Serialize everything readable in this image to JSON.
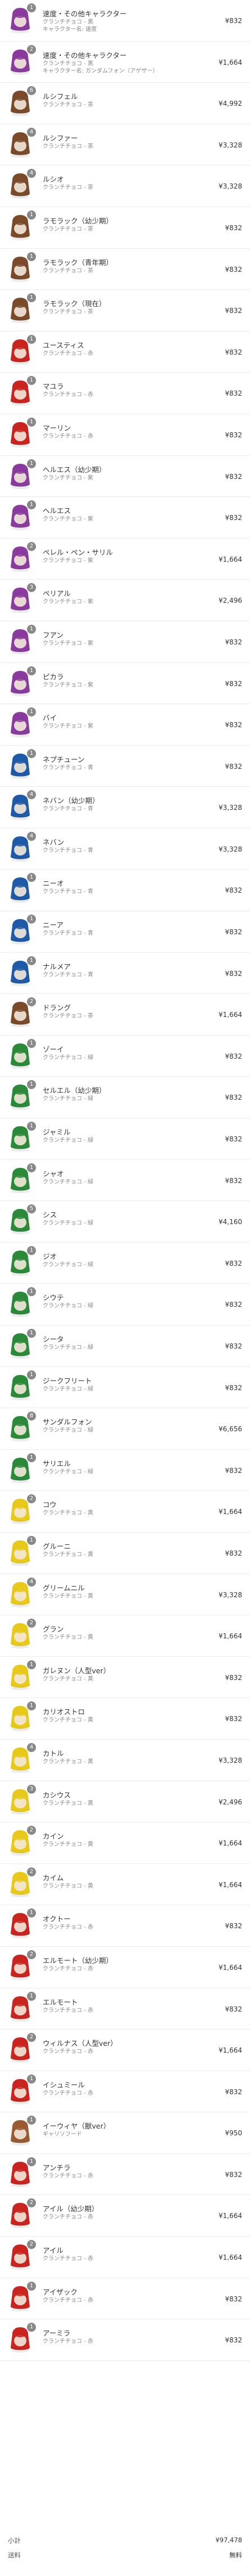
{
  "items": [
    {
      "name": "速度・その他キャラクター",
      "subs": [
        "クランチチョコ - 黒",
        "キャラクター名: 速度"
      ],
      "price": "¥832",
      "qty": "1",
      "color": "#8a3b9e"
    },
    {
      "name": "速度・その他キャラクター",
      "subs": [
        "クランチチョコ - 黒",
        "キャラクター名: ガンダムフォン（アゲザー）"
      ],
      "price": "¥1,664",
      "qty": "2",
      "color": "#8a3b9e"
    },
    {
      "name": "ルシフェル",
      "subs": [
        "クランチチョコ - 茶"
      ],
      "price": "¥4,992",
      "qty": "6",
      "color": "#7a4a2a"
    },
    {
      "name": "ルシファー",
      "subs": [
        "クランチチョコ - 茶"
      ],
      "price": "¥3,328",
      "qty": "4",
      "color": "#7a4a2a"
    },
    {
      "name": "ルシオ",
      "subs": [
        "クランチチョコ - 茶"
      ],
      "price": "¥3,328",
      "qty": "4",
      "color": "#7a4a2a"
    },
    {
      "name": "ラモラック（幼少期）",
      "subs": [
        "クランチチョコ - 茶"
      ],
      "price": "¥832",
      "qty": "1",
      "color": "#7a4a2a"
    },
    {
      "name": "ラモラック（青年期）",
      "subs": [
        "クランチチョコ - 茶"
      ],
      "price": "¥832",
      "qty": "1",
      "color": "#7a4a2a"
    },
    {
      "name": "ラモラック（現在）",
      "subs": [
        "クランチチョコ - 茶"
      ],
      "price": "¥832",
      "qty": "1",
      "color": "#7a4a2a"
    },
    {
      "name": "ユースティス",
      "subs": [
        "クランチチョコ - 赤"
      ],
      "price": "¥832",
      "qty": "1",
      "color": "#c9241f"
    },
    {
      "name": "マユラ",
      "subs": [
        "クランチチョコ - 赤"
      ],
      "price": "¥832",
      "qty": "1",
      "color": "#c9241f"
    },
    {
      "name": "マーリン",
      "subs": [
        "クランチチョコ - 赤"
      ],
      "price": "¥832",
      "qty": "1",
      "color": "#c9241f"
    },
    {
      "name": "ヘルエス（幼少期）",
      "subs": [
        "クランチチョコ - 紫"
      ],
      "price": "¥832",
      "qty": "1",
      "color": "#8a3b9e"
    },
    {
      "name": "ヘルエス",
      "subs": [
        "クランチチョコ - 紫"
      ],
      "price": "¥832",
      "qty": "1",
      "color": "#8a3b9e"
    },
    {
      "name": "ペレル・ペン・サリル",
      "subs": [
        "クランチチョコ - 紫"
      ],
      "price": "¥1,664",
      "qty": "2",
      "color": "#8a3b9e"
    },
    {
      "name": "ペリアル",
      "subs": [
        "クランチチョコ - 紫"
      ],
      "price": "¥2,496",
      "qty": "3",
      "color": "#8a3b9e"
    },
    {
      "name": "フアン",
      "subs": [
        "クランチチョコ - 紫"
      ],
      "price": "¥832",
      "qty": "1",
      "color": "#8a3b9e"
    },
    {
      "name": "ピカラ",
      "subs": [
        "クランチチョコ - 紫"
      ],
      "price": "¥832",
      "qty": "1",
      "color": "#8a3b9e"
    },
    {
      "name": "バイ",
      "subs": [
        "クランチチョコ - 紫"
      ],
      "price": "¥832",
      "qty": "1",
      "color": "#8a3b9e"
    },
    {
      "name": "ネプチューン",
      "subs": [
        "クランチチョコ - 青"
      ],
      "price": "¥832",
      "qty": "1",
      "color": "#1f5aa8"
    },
    {
      "name": "ネバン（幼少期）",
      "subs": [
        "クランチチョコ - 青"
      ],
      "price": "¥3,328",
      "qty": "4",
      "color": "#1f5aa8"
    },
    {
      "name": "ネバン",
      "subs": [
        "クランチチョコ - 青"
      ],
      "price": "¥3,328",
      "qty": "4",
      "color": "#1f5aa8"
    },
    {
      "name": "ニーオ",
      "subs": [
        "クランチチョコ - 青"
      ],
      "price": "¥832",
      "qty": "1",
      "color": "#1f5aa8"
    },
    {
      "name": "ニーア",
      "subs": [
        "クランチチョコ - 青"
      ],
      "price": "¥832",
      "qty": "1",
      "color": "#1f5aa8"
    },
    {
      "name": "ナルメア",
      "subs": [
        "クランチチョコ - 青"
      ],
      "price": "¥832",
      "qty": "1",
      "color": "#1f5aa8"
    },
    {
      "name": "ドラング",
      "subs": [
        "クランチチョコ - 茶"
      ],
      "price": "¥1,664",
      "qty": "2",
      "color": "#7a4a2a"
    },
    {
      "name": "ゾーイ",
      "subs": [
        "クランチチョコ - 緑"
      ],
      "price": "¥832",
      "qty": "1",
      "color": "#2a8a3a"
    },
    {
      "name": "セルエル（幼少期）",
      "subs": [
        "クランチチョコ - 緑"
      ],
      "price": "¥832",
      "qty": "1",
      "color": "#2a8a3a"
    },
    {
      "name": "ジャミル",
      "subs": [
        "クランチチョコ - 緑"
      ],
      "price": "¥832",
      "qty": "1",
      "color": "#2a8a3a"
    },
    {
      "name": "シャオ",
      "subs": [
        "クランチチョコ - 緑"
      ],
      "price": "¥832",
      "qty": "1",
      "color": "#2a8a3a"
    },
    {
      "name": "シス",
      "subs": [
        "クランチチョコ - 緑"
      ],
      "price": "¥4,160",
      "qty": "5",
      "color": "#2a8a3a"
    },
    {
      "name": "ジオ",
      "subs": [
        "クランチチョコ - 緑"
      ],
      "price": "¥832",
      "qty": "1",
      "color": "#2a8a3a"
    },
    {
      "name": "シウテ",
      "subs": [
        "クランチチョコ - 緑"
      ],
      "price": "¥832",
      "qty": "1",
      "color": "#2a8a3a"
    },
    {
      "name": "シータ",
      "subs": [
        "クランチチョコ - 緑"
      ],
      "price": "¥832",
      "qty": "1",
      "color": "#2a8a3a"
    },
    {
      "name": "ジークフリート",
      "subs": [
        "クランチチョコ - 緑"
      ],
      "price": "¥832",
      "qty": "1",
      "color": "#2a8a3a"
    },
    {
      "name": "サンダルフォン",
      "subs": [
        "クランチチョコ - 緑"
      ],
      "price": "¥6,656",
      "qty": "8",
      "color": "#2a8a3a"
    },
    {
      "name": "サリエル",
      "subs": [
        "クランチチョコ - 緑"
      ],
      "price": "¥832",
      "qty": "1",
      "color": "#2a8a3a"
    },
    {
      "name": "コウ",
      "subs": [
        "クランチチョコ - 黄"
      ],
      "price": "¥1,664",
      "qty": "2",
      "color": "#e8c91a"
    },
    {
      "name": "グルーニ",
      "subs": [
        "クランチチョコ - 黄"
      ],
      "price": "¥832",
      "qty": "1",
      "color": "#e8c91a"
    },
    {
      "name": "グリームニル",
      "subs": [
        "クランチチョコ - 黄"
      ],
      "price": "¥3,328",
      "qty": "4",
      "color": "#e8c91a"
    },
    {
      "name": "グラン",
      "subs": [
        "クランチチョコ - 黄"
      ],
      "price": "¥1,664",
      "qty": "2",
      "color": "#e8c91a"
    },
    {
      "name": "ガレヌン（人型ver）",
      "subs": [
        "クランチチョコ - 黄"
      ],
      "price": "¥832",
      "qty": "1",
      "color": "#e8c91a"
    },
    {
      "name": "カリオストロ",
      "subs": [
        "クランチチョコ - 黄"
      ],
      "price": "¥832",
      "qty": "1",
      "color": "#e8c91a"
    },
    {
      "name": "カトル",
      "subs": [
        "クランチチョコ - 黄"
      ],
      "price": "¥3,328",
      "qty": "4",
      "color": "#e8c91a"
    },
    {
      "name": "カシウス",
      "subs": [
        "クランチチョコ - 黄"
      ],
      "price": "¥2,496",
      "qty": "3",
      "color": "#e8c91a"
    },
    {
      "name": "カイン",
      "subs": [
        "クランチチョコ - 黄"
      ],
      "price": "¥1,664",
      "qty": "2",
      "color": "#e8c91a"
    },
    {
      "name": "カイム",
      "subs": [
        "クランチチョコ - 黄"
      ],
      "price": "¥1,664",
      "qty": "2",
      "color": "#e8c91a"
    },
    {
      "name": "オクトー",
      "subs": [
        "クランチチョコ - 赤"
      ],
      "price": "¥832",
      "qty": "1",
      "color": "#c9241f"
    },
    {
      "name": "エルモート（幼少期）",
      "subs": [
        "クランチチョコ - 赤"
      ],
      "price": "¥1,664",
      "qty": "2",
      "color": "#c9241f"
    },
    {
      "name": "エルモート",
      "subs": [
        "クランチチョコ - 赤"
      ],
      "price": "¥832",
      "qty": "1",
      "color": "#c9241f"
    },
    {
      "name": "ウィルナス（人型ver）",
      "subs": [
        "クランチチョコ - 赤"
      ],
      "price": "¥1,664",
      "qty": "2",
      "color": "#c9241f"
    },
    {
      "name": "イシュミール",
      "subs": [
        "クランチチョコ - 赤"
      ],
      "price": "¥832",
      "qty": "1",
      "color": "#c9241f"
    },
    {
      "name": "イーウィヤ（獣ver）",
      "subs": [
        "ギャリソフード"
      ],
      "price": "¥950",
      "qty": "1",
      "color": "#9a5a32"
    },
    {
      "name": "アンチラ",
      "subs": [
        "クランチチョコ - 赤"
      ],
      "price": "¥832",
      "qty": "1",
      "color": "#c9241f"
    },
    {
      "name": "アイル（幼少期）",
      "subs": [
        "クランチチョコ - 赤"
      ],
      "price": "¥1,664",
      "qty": "2",
      "color": "#c9241f"
    },
    {
      "name": "アイル",
      "subs": [
        "クランチチョコ - 赤"
      ],
      "price": "¥1,664",
      "qty": "2",
      "color": "#c9241f"
    },
    {
      "name": "アイザック",
      "subs": [
        "クランチチョコ - 赤"
      ],
      "price": "¥832",
      "qty": "1",
      "color": "#c9241f"
    },
    {
      "name": "アーミラ",
      "subs": [
        "クランチチョコ - 赤"
      ],
      "price": "¥832",
      "qty": "1",
      "color": "#c9241f"
    }
  ],
  "summary": {
    "subtotal_label": "小計",
    "subtotal_value": "¥97,478",
    "shipping_label": "送料",
    "shipping_value": "無料"
  }
}
